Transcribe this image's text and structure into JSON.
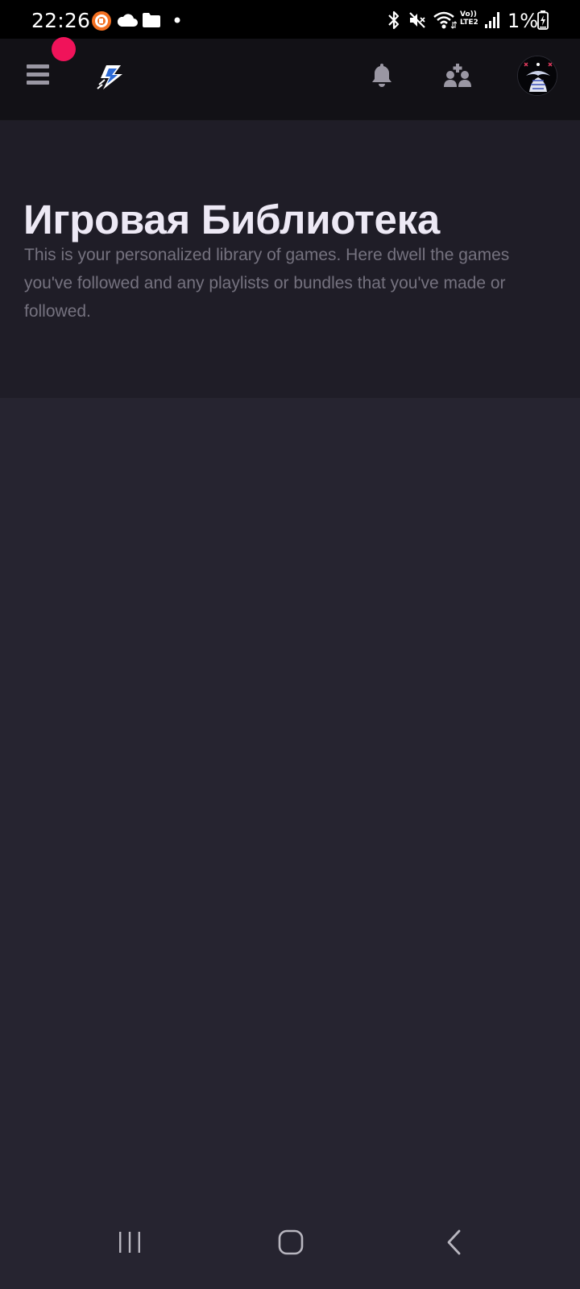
{
  "status_bar": {
    "time": "22:26",
    "network_label_top": "Vo))",
    "network_label_bottom": "LTE2",
    "battery": "1%",
    "icons": [
      "screen-recorder-icon",
      "cloud-icon",
      "folder-icon",
      "dot-icon",
      "bluetooth-icon",
      "mute-icon",
      "wifi-icon",
      "signal-icon",
      "battery-charging-icon"
    ]
  },
  "header": {
    "icons": [
      "menu-icon",
      "lightning-logo-icon",
      "bell-icon",
      "add-friend-icon",
      "avatar"
    ],
    "accent_color": "#F0135A"
  },
  "hero": {
    "title": "Игровая Библиотека",
    "description": "This is your personalized library of games. Here dwell the games you've followed and any playlists or bundles that you've made or followed."
  },
  "nav_bar": {
    "icons": [
      "recent-apps-icon",
      "home-icon",
      "back-icon"
    ]
  }
}
